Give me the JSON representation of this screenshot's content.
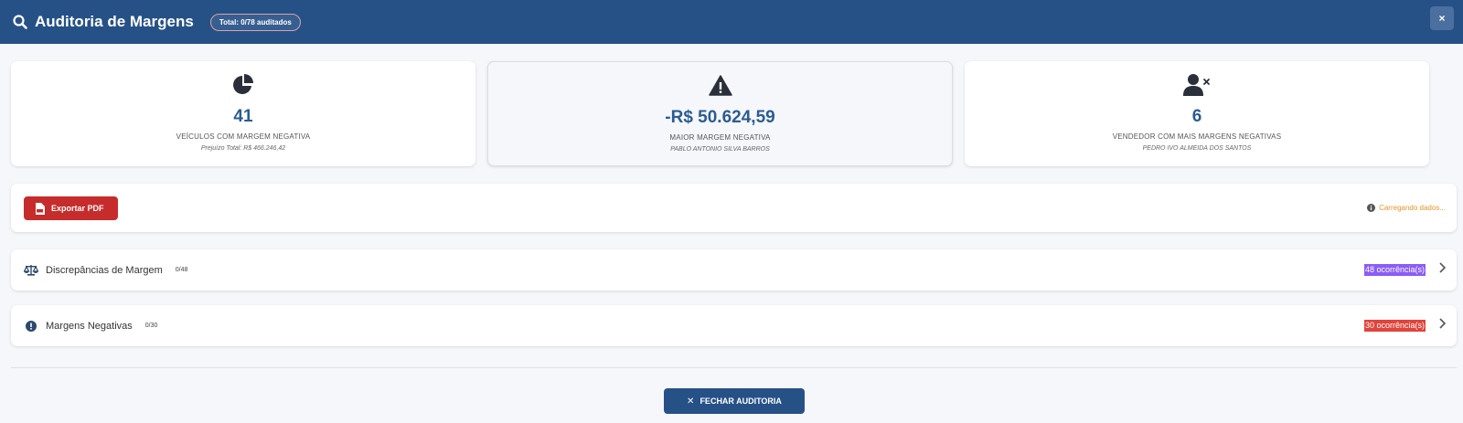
{
  "header": {
    "title": "Auditoria de Margens",
    "badge": "Total: 0/78 auditados",
    "close_label": "×"
  },
  "cards": [
    {
      "value": "41",
      "label": "VEÍCULOS COM MARGEM NEGATIVA",
      "sub": "Prejuízo Total: R$ 466.246,42",
      "icon": "pie-chart-icon"
    },
    {
      "value": "-R$ 50.624,59",
      "label": "MAIOR MARGEM NEGATIVA",
      "sub": "PABLO ANTONIO SILVA BARROS",
      "icon": "warning-icon"
    },
    {
      "value": "6",
      "label": "VENDEDOR COM MAIS MARGENS NEGATIVAS",
      "sub": "PEDRO IVO ALMEIDA DOS SANTOS",
      "icon": "user-x-icon"
    }
  ],
  "toolbar": {
    "export_label": "Exportar PDF",
    "loading_text": "Carregando dados..."
  },
  "sections": [
    {
      "title": "Discrepâncias de Margem",
      "count": "0/48",
      "occurrences": "48 ocorrência(s)",
      "color": "#8b5cf6",
      "icon": "scale-icon"
    },
    {
      "title": "Margens Negativas",
      "count": "0/30",
      "occurrences": "30 ocorrência(s)",
      "color": "#e0443b",
      "icon": "exclamation-circle-icon"
    }
  ],
  "footer": {
    "close_label": "FECHAR AUDITORIA"
  },
  "colors": {
    "primary": "#265187",
    "accent_value": "#2b5c92",
    "danger": "#c72c2c",
    "warning": "#e8952b"
  }
}
